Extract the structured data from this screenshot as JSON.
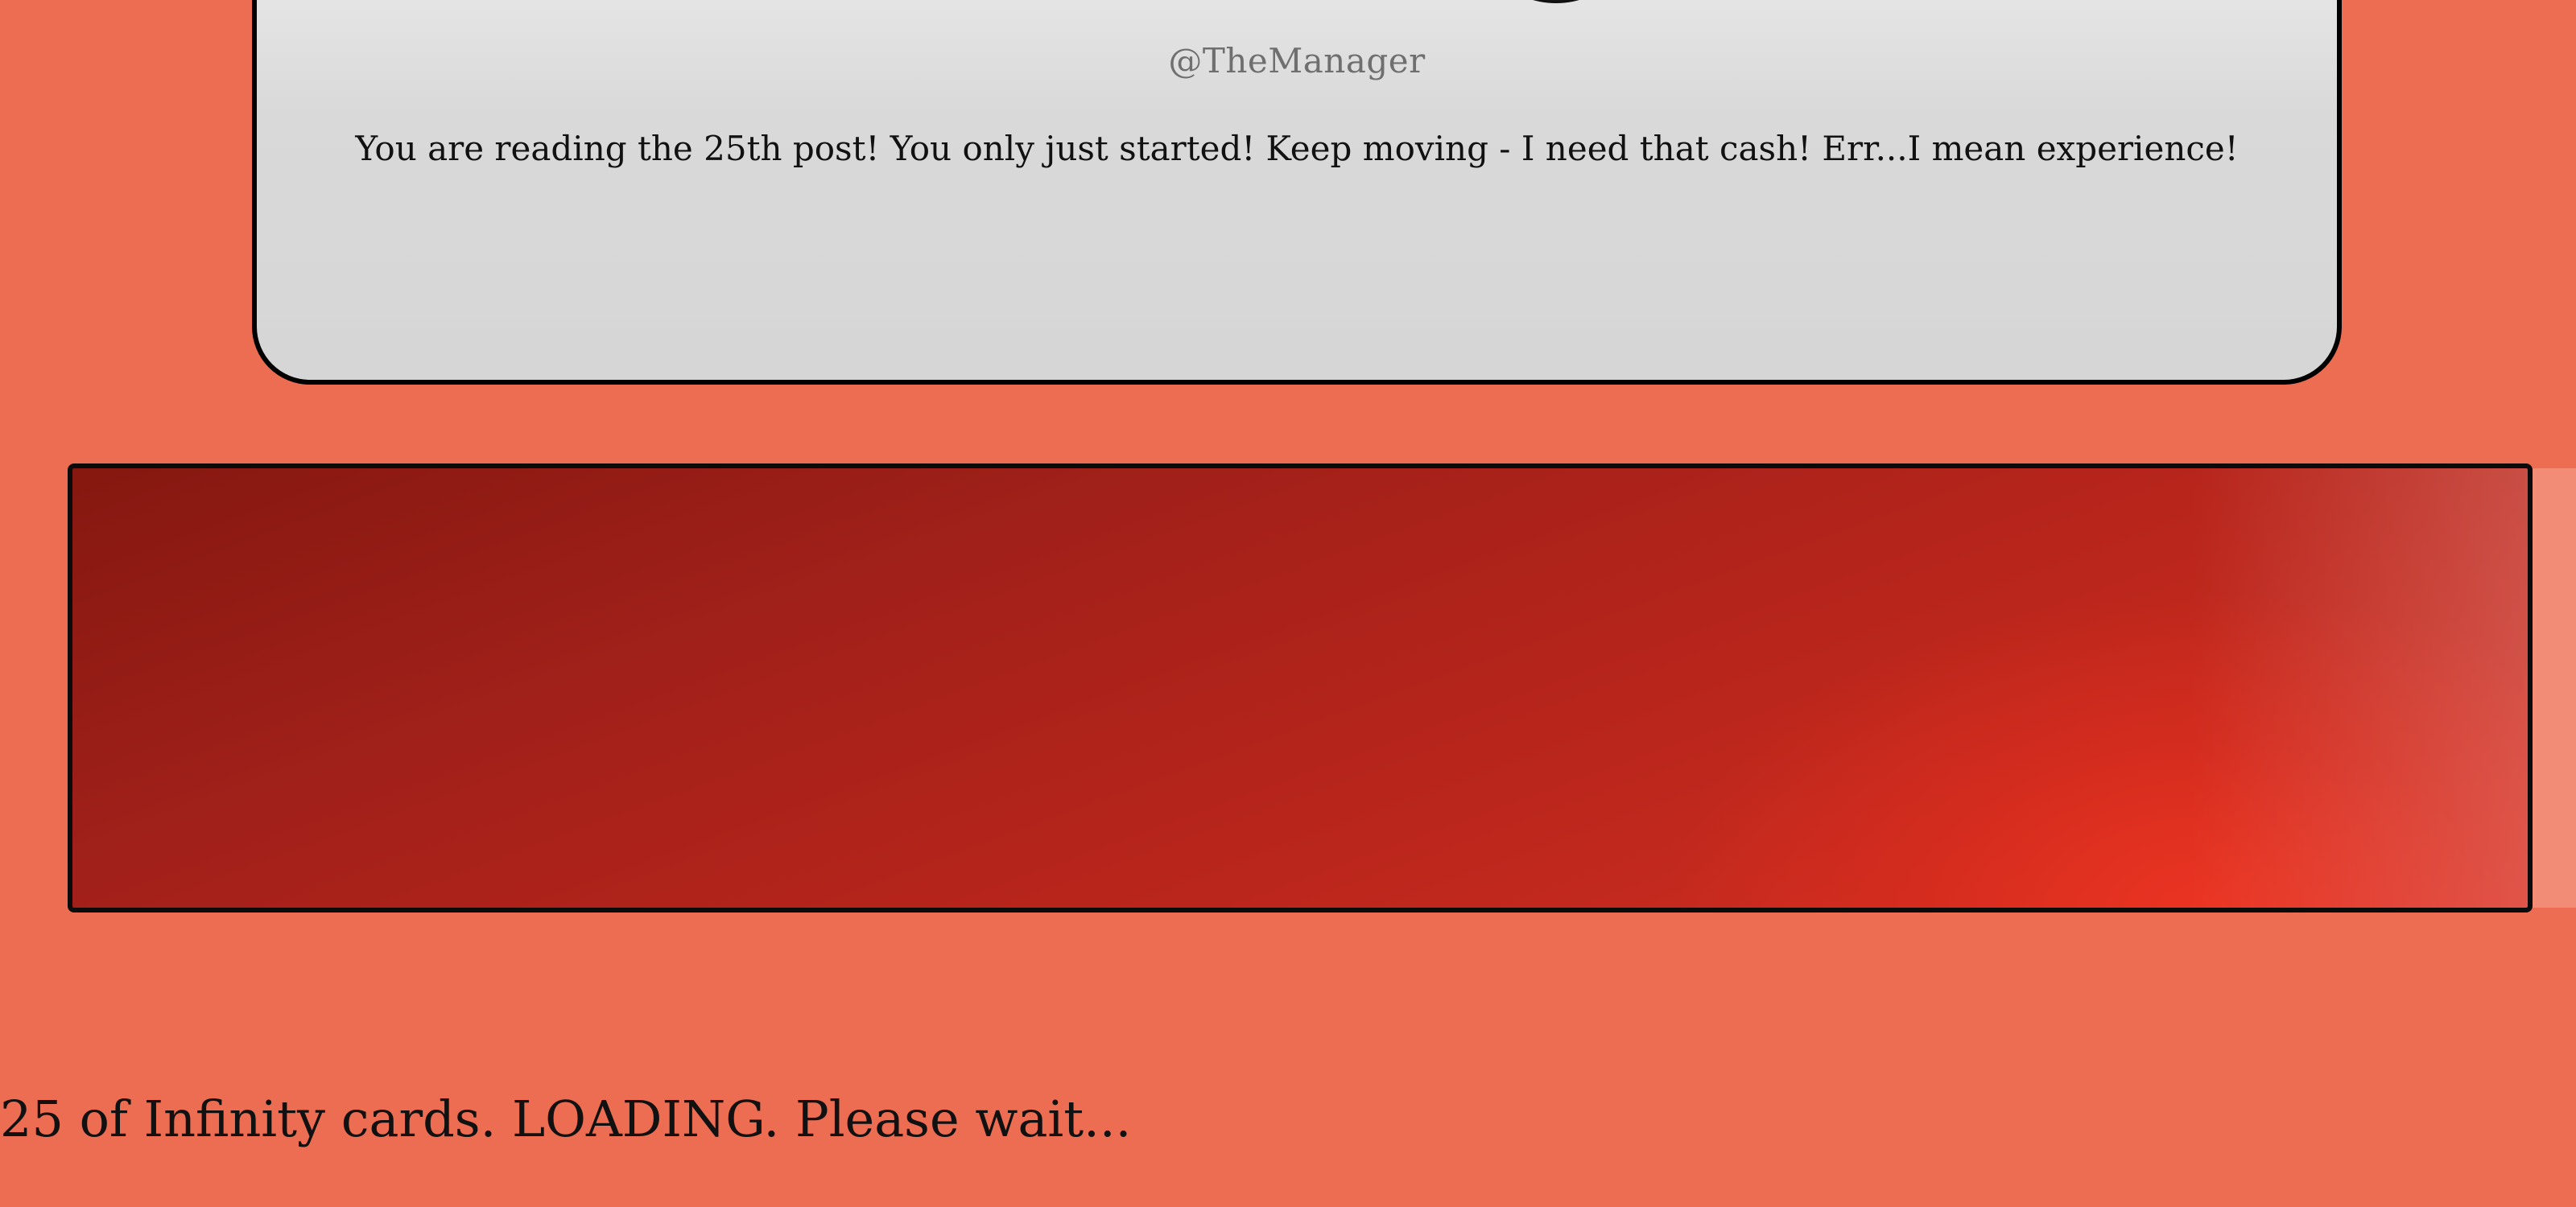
{
  "post": {
    "handle": "@TheManager",
    "text": "You are reading the 25th post! You only just started! Keep moving - I need that cash! Err...I mean experience!",
    "avatar_icon": "avatar-silhouette-icon"
  },
  "loader": {
    "status": "25 of Infinity cards. LOADING. Please wait..."
  },
  "colors": {
    "background": "#ed6d52",
    "card": "#d6d6d6",
    "banner_dark": "#851810",
    "banner_light": "#d83225",
    "text": "#111111",
    "handle": "#6f6f6f"
  }
}
